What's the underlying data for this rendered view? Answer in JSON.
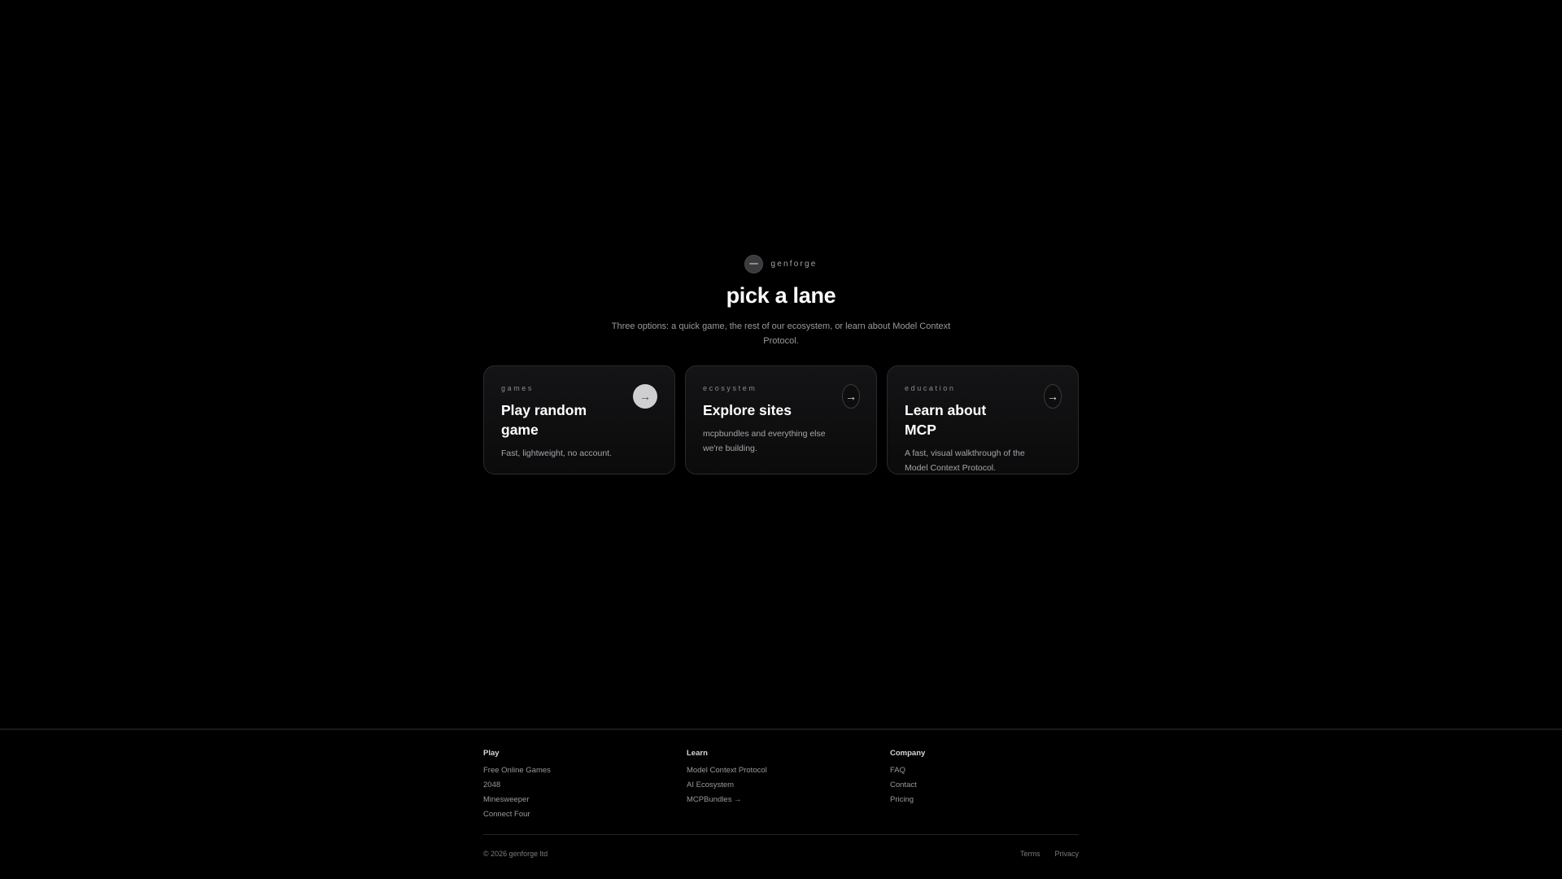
{
  "brand": {
    "name": "genforge"
  },
  "hero": {
    "title": "pick a lane",
    "subtitle": "Three options: a quick game, the rest of our ecosystem, or learn about Model Context Protocol."
  },
  "cards": [
    {
      "tag": "games",
      "title": "Play random game",
      "description": "Fast, lightweight, no account.",
      "arrow": "→",
      "arrow_icon": "arrow-right-icon"
    },
    {
      "tag": "ecosystem",
      "title": "Explore sites",
      "description": "mcpbundles and everything else we're building.",
      "arrow": "→",
      "arrow_icon": "arrow-right-icon"
    },
    {
      "tag": "education",
      "title": "Learn about MCP",
      "description": "A fast, visual walkthrough of the Model Context Protocol.",
      "arrow": "→",
      "arrow_icon": "arrow-right-icon"
    }
  ],
  "footer": {
    "columns": [
      {
        "heading": "Play",
        "links": [
          "Free Online Games",
          "2048",
          "Minesweeper",
          "Connect Four"
        ]
      },
      {
        "heading": "Learn",
        "links": [
          "Model Context Protocol",
          "AI Ecosystem",
          "MCPBundles →"
        ]
      },
      {
        "heading": "Company",
        "links": [
          "FAQ",
          "Contact",
          "Pricing"
        ]
      }
    ],
    "copyright": "© 2026 genforge ltd",
    "legal": [
      "Terms",
      "Privacy"
    ]
  },
  "colors": {
    "background": "#000000",
    "card_border": "#2a2a2d",
    "primary_arrow": "#cfcfd1",
    "text": "#ffffff",
    "muted_text": "#9a9a9e"
  }
}
